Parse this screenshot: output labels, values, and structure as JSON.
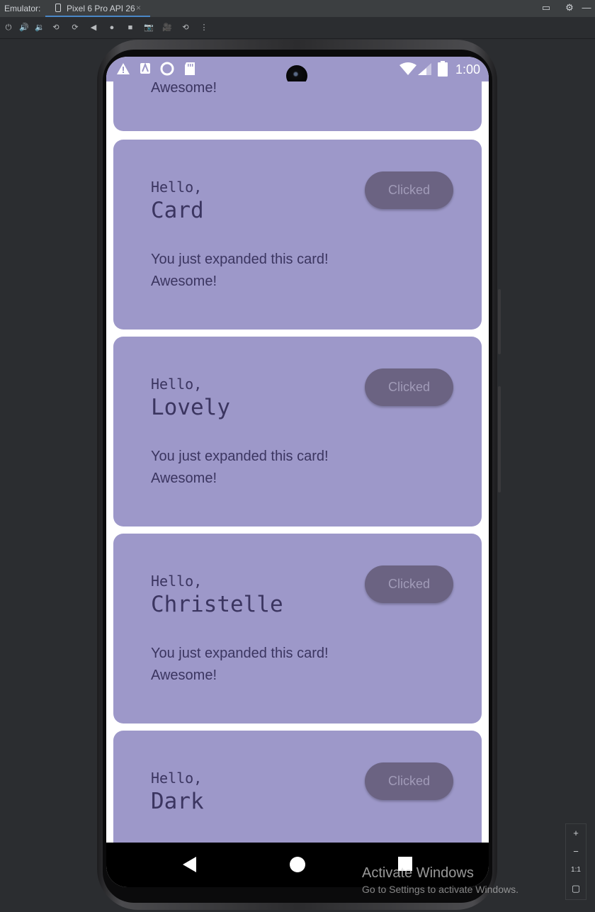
{
  "ide": {
    "label": "Emulator:",
    "tab_name": "Pixel 6 Pro API 26",
    "tab_close": "×",
    "toolbar": [
      {
        "name": "power-icon",
        "glyph": "⏻"
      },
      {
        "name": "volume-up-icon",
        "glyph": "🔊"
      },
      {
        "name": "volume-down-icon",
        "glyph": "🔉"
      },
      {
        "name": "rotate-left-icon",
        "glyph": "⟲"
      },
      {
        "name": "rotate-right-icon",
        "glyph": "⟳"
      },
      {
        "name": "back-icon",
        "glyph": "◀"
      },
      {
        "name": "home-icon",
        "glyph": "●"
      },
      {
        "name": "overview-icon",
        "glyph": "■"
      },
      {
        "name": "screenshot-icon",
        "glyph": "📷"
      },
      {
        "name": "screen-record-icon",
        "glyph": "🎥"
      },
      {
        "name": "snapshot-icon",
        "glyph": "⟲"
      },
      {
        "name": "more-icon",
        "glyph": "⋮"
      }
    ],
    "window_button": "▭",
    "settings_button": "⚙",
    "minimize_button": "—",
    "zoom_controls": [
      "+",
      "−",
      "1:1",
      "▢"
    ]
  },
  "status_bar": {
    "time": "1:00",
    "icons": [
      "warning-icon",
      "a-icon",
      "circle-icon",
      "sd-card-icon",
      "wifi-icon",
      "signal-icon",
      "battery-icon"
    ]
  },
  "app": {
    "partial_top_text": "Awesome!",
    "cards": [
      {
        "greeting": "Hello,",
        "name": "Card",
        "button": "Clicked",
        "body_line1": "You just expanded this card!",
        "body_line2": "Awesome!"
      },
      {
        "greeting": "Hello,",
        "name": "Lovely",
        "button": "Clicked",
        "body_line1": "You just expanded this card!",
        "body_line2": "Awesome!"
      },
      {
        "greeting": "Hello,",
        "name": "Christelle",
        "button": "Clicked",
        "body_line1": "You just expanded this card!",
        "body_line2": "Awesome!"
      },
      {
        "greeting": "Hello,",
        "name": "Dark",
        "button": "Clicked",
        "body_line1": "",
        "body_line2": ""
      }
    ]
  },
  "watermark": {
    "line1": "Activate Windows",
    "line2": "Go to Settings to activate Windows."
  },
  "colors": {
    "card": "#9d98c9",
    "button": "#6b6382",
    "text": "#3b3560"
  }
}
